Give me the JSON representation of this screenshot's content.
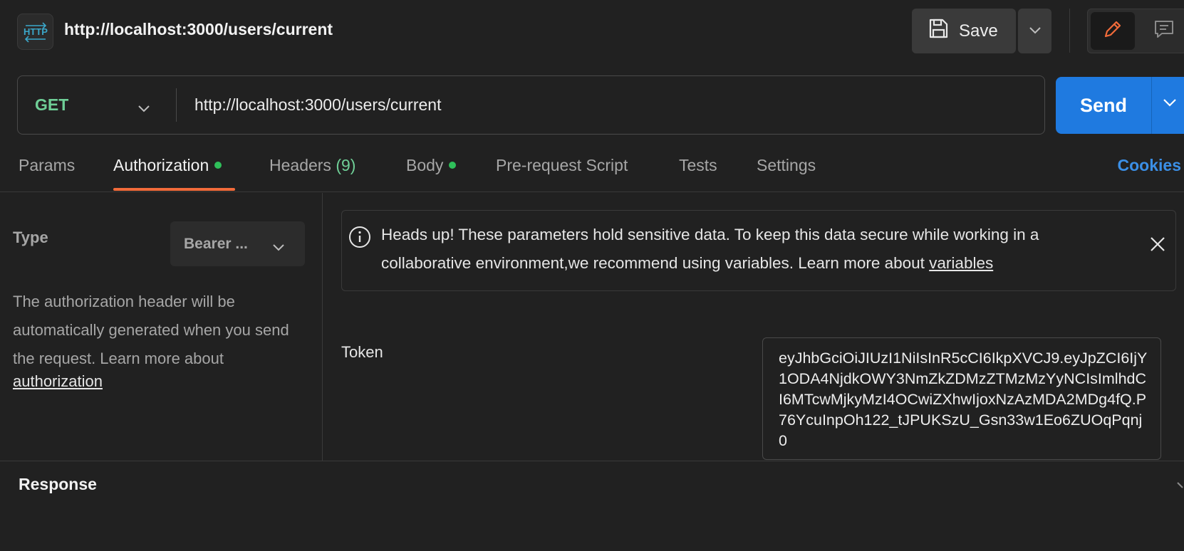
{
  "header": {
    "badge_text": "HTTP",
    "request_title": "http://localhost:3000/users/current",
    "save_label": "Save"
  },
  "request": {
    "method": "GET",
    "url": "http://localhost:3000/users/current",
    "send_label": "Send"
  },
  "tabs": [
    {
      "label": "Params"
    },
    {
      "label": "Authorization",
      "active": true,
      "dot": true
    },
    {
      "label": "Headers",
      "count": "(9)"
    },
    {
      "label": "Body",
      "dot": true
    },
    {
      "label": "Pre-request Script"
    },
    {
      "label": "Tests"
    },
    {
      "label": "Settings"
    }
  ],
  "cookies_label": "Cookies",
  "auth": {
    "type_label": "Type",
    "type_value": "Bearer ...",
    "description": "The authorization header will be automatically generated when you send the request. Learn more about",
    "link_text": "authorization"
  },
  "warning": {
    "text": "Heads up! These parameters hold sensitive data. To keep this data secure while working in a collaborative environment,we recommend using variables. Learn more about",
    "link_text": "variables"
  },
  "token": {
    "label": "Token",
    "value": "eyJhbGciOiJIUzI1NiIsInR5cCI6IkpXVCJ9.eyJpZCI6IjY1ODA4NjdkOWY3NmZkZDMzZTMzMzYyNCIsImlhdCI6MTcwMjkyMzI4OCwiZXhwIjoxNzAzMDA2MDg4fQ.P76YcuInpOh122_tJPUKSzU_Gsn33w1Eo6ZUOqPqnj0"
  },
  "response": {
    "title": "Response"
  },
  "colors": {
    "method_get": "#6fcf97",
    "send_button": "#1f7ae0",
    "active_tab_underline": "#f26b3a",
    "status_dot": "#2fbf5a",
    "cookies_link": "#3b8fe6"
  }
}
